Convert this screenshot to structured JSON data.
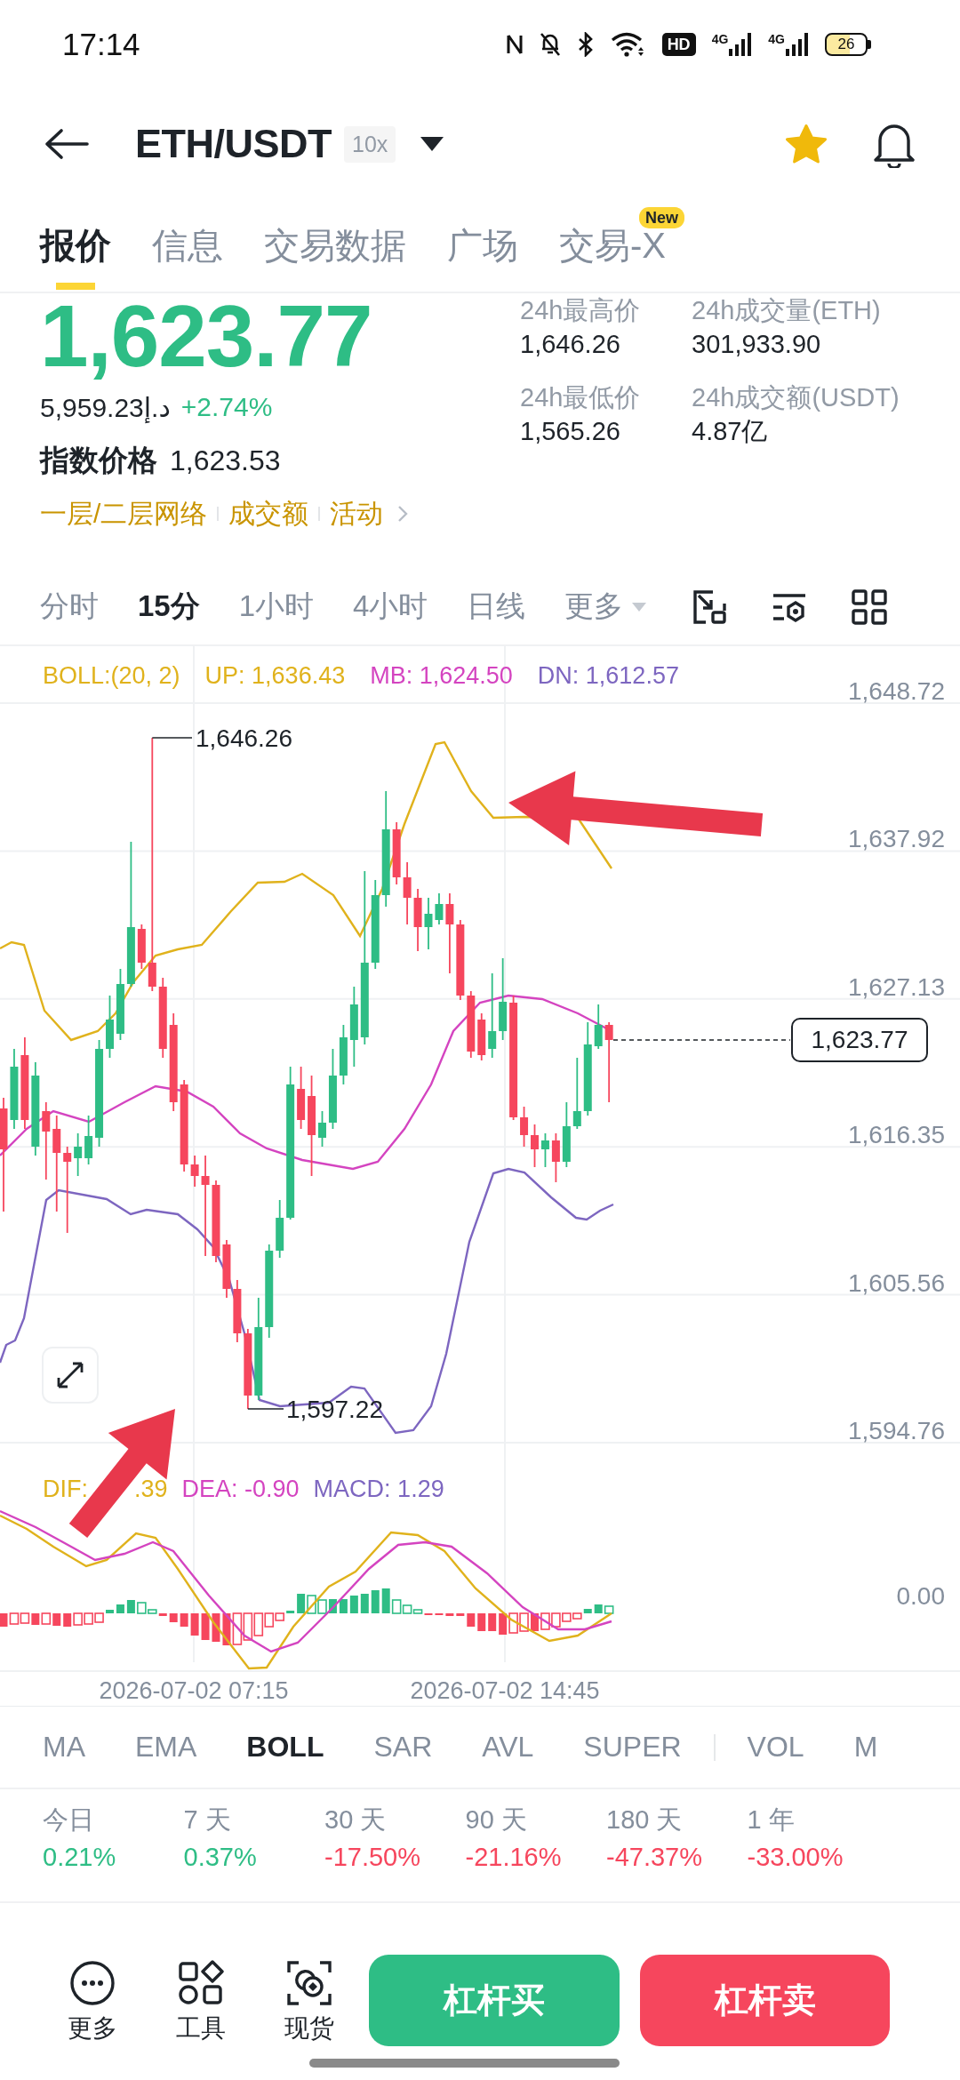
{
  "status_bar": {
    "time": "17:14",
    "hd_label": "HD",
    "networks": [
      "4G",
      "4G"
    ],
    "battery": "26"
  },
  "header": {
    "title": "ETH/USDT",
    "leverage": "10x",
    "favorite": true
  },
  "tabs": [
    {
      "label": "报价",
      "selected": true
    },
    {
      "label": "信息",
      "selected": false
    },
    {
      "label": "交易数据",
      "selected": false
    },
    {
      "label": "广场",
      "selected": false
    },
    {
      "label": "交易-X",
      "selected": false,
      "badge": "New"
    }
  ],
  "price": {
    "last": "1,623.77",
    "fiat": "5,959.23د.إ",
    "change": "+2.74%",
    "index_label": "指数价格",
    "index_value": "1,623.53",
    "tags": [
      "一层/二层网络",
      "成交额",
      "活动"
    ]
  },
  "stats": [
    {
      "label": "24h最高价",
      "value": "1,646.26"
    },
    {
      "label": "24h成交量(ETH)",
      "value": "301,933.90"
    },
    {
      "label": "24h最低价",
      "value": "1,565.26"
    },
    {
      "label": "24h成交额(USDT)",
      "value": "4.87亿"
    }
  ],
  "intervals": [
    {
      "label": "分时",
      "kind": "option",
      "selected": false
    },
    {
      "label": "15分",
      "kind": "option",
      "selected": true
    },
    {
      "label": "1小时",
      "kind": "option",
      "selected": false
    },
    {
      "label": "4小时",
      "kind": "option",
      "selected": false
    },
    {
      "label": "日线",
      "kind": "option",
      "selected": false
    },
    {
      "label": "更多",
      "kind": "menu",
      "selected": false
    }
  ],
  "chart": {
    "legend": [
      {
        "text": "BOLL:(20, 2)",
        "color": "#e0b21c"
      },
      {
        "text": "UP: 1,636.43",
        "color": "#e0b21c"
      },
      {
        "text": "MB: 1,624.50",
        "color": "#d444c0"
      },
      {
        "text": "DN: 1,612.57",
        "color": "#7d66c0"
      }
    ],
    "price_axis": [
      "1,648.72",
      "1,637.92",
      "1,627.13",
      "1,616.35",
      "1,605.56",
      "1,594.76"
    ],
    "high_label": "1,646.26",
    "low_label": "1,597.22",
    "last_price": "1,623.77"
  },
  "macd": {
    "legend": [
      {
        "text": "DIF:",
        "color": "#e0b21c"
      },
      {
        "text": ".39",
        "color": "#e0b21c"
      },
      {
        "text": "DEA: -0.90",
        "color": "#d444c0"
      },
      {
        "text": "MACD: 1.29",
        "color": "#7d66c0"
      }
    ],
    "axis_label": "0.00",
    "time_labels": [
      "2026-07-02 07:15",
      "2026-07-02 14:45"
    ]
  },
  "indicators": {
    "main": [
      {
        "label": "MA",
        "selected": false
      },
      {
        "label": "EMA",
        "selected": false
      },
      {
        "label": "BOLL",
        "selected": true
      },
      {
        "label": "SAR",
        "selected": false
      },
      {
        "label": "AVL",
        "selected": false
      },
      {
        "label": "SUPER",
        "selected": false
      }
    ],
    "sub": [
      {
        "label": "VOL",
        "selected": false
      },
      {
        "label": "M",
        "selected": false
      }
    ]
  },
  "periods": [
    {
      "label": "今日",
      "value": "0.21%",
      "color": "#2ebd85"
    },
    {
      "label": "7 天",
      "value": "0.37%",
      "color": "#2ebd85"
    },
    {
      "label": "30 天",
      "value": "-17.50%",
      "color": "#f6465d"
    },
    {
      "label": "90 天",
      "value": "-21.16%",
      "color": "#f6465d"
    },
    {
      "label": "180 天",
      "value": "-47.37%",
      "color": "#f6465d"
    },
    {
      "label": "1 年",
      "value": "-33.00%",
      "color": "#f6465d"
    }
  ],
  "bottom_bar": {
    "actions": [
      {
        "label": "更多",
        "kind": "more"
      },
      {
        "label": "工具",
        "kind": "tools"
      },
      {
        "label": "现货",
        "kind": "spot"
      }
    ],
    "buy": "杠杆买",
    "sell": "杠杆卖"
  }
}
